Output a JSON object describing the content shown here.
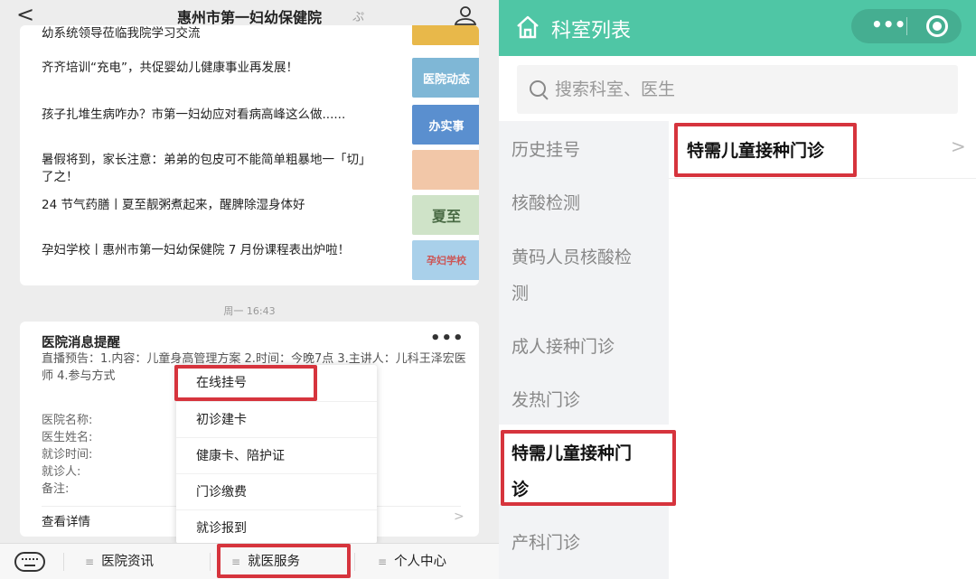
{
  "left": {
    "header": {
      "back_glyph": "<",
      "title": "惠州市第一妇幼保健院",
      "title_mark": "ぷ"
    },
    "articles": [
      {
        "text": "幼系统领导莅临我院学习交流",
        "thumb": "",
        "thumb_color": "#e8b84a"
      },
      {
        "text": "齐齐培训“充电”，共促婴幼儿健康事业再发展！",
        "thumb": "医院动态",
        "thumb_color": "#7fb7d6"
      },
      {
        "text": "孩子扎堆生病咋办？市第一妇幼应对看病高峰这么做......",
        "thumb": "办实事",
        "thumb_color": "#5a8fcf"
      },
      {
        "text": "暑假将到，家长注意：弟弟的包皮可不能简单粗暴地一「切」了之！",
        "thumb": "",
        "thumb_color": "#f2c7a8"
      },
      {
        "text": "24 节气药膳丨夏至靓粥煮起来，醒脾除湿身体好",
        "thumb": "夏至",
        "thumb_color": "#cfe3c8"
      },
      {
        "text": "孕妇学校丨惠州市第一妇幼保健院 7 月份课程表出炉啦！",
        "thumb": "孕妇学校",
        "thumb_color": "#a9d0ea"
      }
    ],
    "timestamp": "周一 16:43",
    "notice": {
      "title": "医院消息提醒",
      "more": "•••",
      "body": "直播预告：1.内容：儿童身高管理方案 2.时间：今晚7点 3.主讲人：儿科王泽宏医师 4.参与方式",
      "fields": [
        "医院名称:",
        "医生姓名:",
        "就诊时间:",
        "就诊人:",
        "备注:"
      ],
      "detail": "查看详情",
      "arrow": ">"
    },
    "popup": [
      "在线挂号",
      "初诊建卡",
      "健康卡、陪护证",
      "门诊缴费",
      "就诊报到"
    ],
    "bottom_nav": {
      "hamburger": "≡",
      "items": [
        "医院资讯",
        "就医服务",
        "个人中心"
      ]
    }
  },
  "right": {
    "header": {
      "title": "科室列表",
      "capsule_dots": "•••"
    },
    "search": {
      "placeholder": "搜索科室、医生"
    },
    "sidebar": [
      {
        "label": "历史挂号"
      },
      {
        "label": "核酸检测"
      },
      {
        "label": "黄码人员核酸检"
      },
      {
        "label": "测"
      },
      {
        "label": "成人接种门诊"
      },
      {
        "label": "发热门诊"
      },
      {
        "label": "特需儿童接种门"
      },
      {
        "label": "诊"
      },
      {
        "label": "产科门诊"
      }
    ],
    "list": [
      {
        "label": "特需儿童接种门诊",
        "arrow": ">"
      }
    ]
  },
  "colors": {
    "header_green": "#4fc6a5",
    "highlight_red": "#d6343d"
  }
}
